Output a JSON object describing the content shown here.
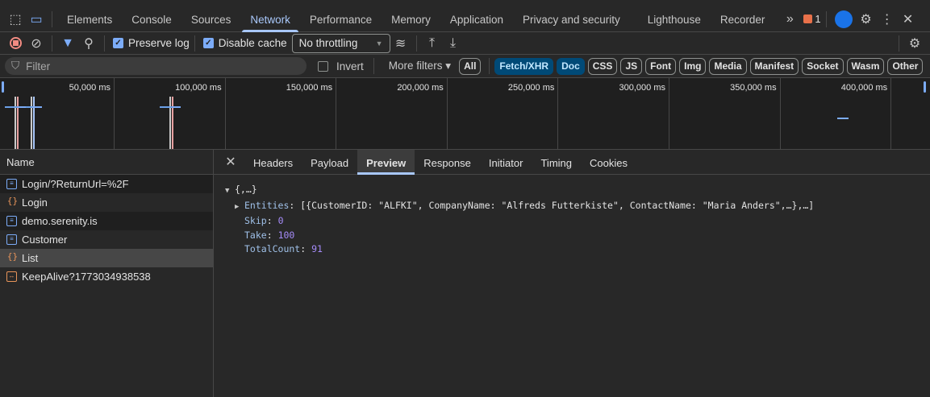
{
  "tabs": [
    "Elements",
    "Console",
    "Sources",
    "Network",
    "Performance",
    "Memory",
    "Application",
    "Privacy and security",
    "Lighthouse",
    "Recorder"
  ],
  "active_tab": "Network",
  "issues_count": "1",
  "toolbar": {
    "preserve_log": "Preserve log",
    "disable_cache": "Disable cache",
    "throttling": "No throttling"
  },
  "filter": {
    "placeholder": "Filter",
    "invert": "Invert",
    "more_filters": "More filters"
  },
  "type_chips": [
    "All",
    "Fetch/XHR",
    "Doc",
    "CSS",
    "JS",
    "Font",
    "Img",
    "Media",
    "Manifest",
    "Socket",
    "Wasm",
    "Other"
  ],
  "overview_ticks": [
    "50,000 ms",
    "100,000 ms",
    "150,000 ms",
    "200,000 ms",
    "250,000 ms",
    "300,000 ms",
    "350,000 ms",
    "400,000 ms"
  ],
  "requests": {
    "header": "Name",
    "items": [
      {
        "name": "Login/?ReturnUrl=%2F",
        "type": "doc"
      },
      {
        "name": "Login",
        "type": "xhr"
      },
      {
        "name": "demo.serenity.is",
        "type": "doc"
      },
      {
        "name": "Customer",
        "type": "doc"
      },
      {
        "name": "List",
        "type": "xhr"
      },
      {
        "name": "KeepAlive?1773034938538",
        "type": "ka"
      }
    ]
  },
  "detail_tabs": [
    "Headers",
    "Payload",
    "Preview",
    "Response",
    "Initiator",
    "Timing",
    "Cookies"
  ],
  "preview": {
    "root": "{,…}",
    "entities_key": "Entities",
    "entities_value": "[{CustomerID: \"ALFKI\", CompanyName: \"Alfreds Futterkiste\", ContactName: \"Maria Anders\",…},…]",
    "skip_key": "Skip",
    "skip": "0",
    "take_key": "Take",
    "take": "100",
    "total_key": "TotalCount",
    "total": "91"
  }
}
